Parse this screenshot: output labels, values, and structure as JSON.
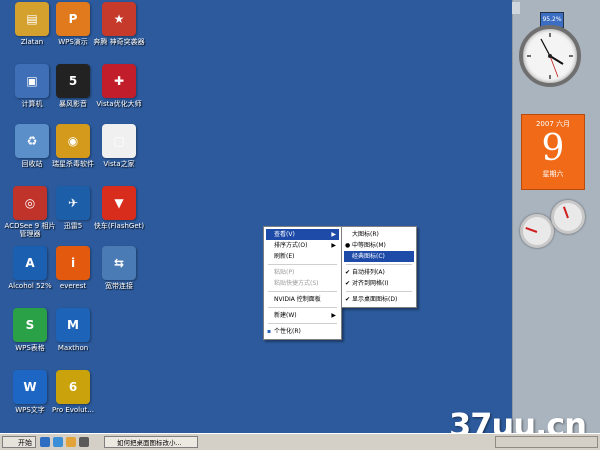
{
  "desktop_icons": [
    {
      "name": "zlatan-folder",
      "label": "Zlatan",
      "color": "#d4a12e",
      "glyph": "▤"
    },
    {
      "name": "wps-presentation",
      "label": "WPS演示",
      "color": "#e07a1c",
      "glyph": "P"
    },
    {
      "name": "benteng-game",
      "label": "奔腾 神奇突袭器",
      "color": "#c63a2c",
      "glyph": "★"
    },
    {
      "name": "computer",
      "label": "计算机",
      "color": "#3f6fb6",
      "glyph": "▣"
    },
    {
      "name": "baofeng-player",
      "label": "暴风影音",
      "color": "#222222",
      "glyph": "5"
    },
    {
      "name": "vista-optimizer",
      "label": "Vista优化大师",
      "color": "#c21d2a",
      "glyph": "✚"
    },
    {
      "name": "recycle-bin",
      "label": "回收站",
      "color": "#5a8fc9",
      "glyph": "♻"
    },
    {
      "name": "rising-antivirus",
      "label": "瑞星杀毒软件",
      "color": "#d49a1c",
      "glyph": "◉"
    },
    {
      "name": "vista-home",
      "label": "Vista之家",
      "color": "#f0f0f0",
      "glyph": "▢"
    },
    {
      "name": "acdsee",
      "label": "ACDSee 9 相片管理器",
      "color": "#c0332a",
      "glyph": "◎"
    },
    {
      "name": "thunder5",
      "label": "迅雷5",
      "color": "#1d5ea8",
      "glyph": "✈"
    },
    {
      "name": "flashget",
      "label": "快车(FlashGet)",
      "color": "#d82c1c",
      "glyph": "▼"
    },
    {
      "name": "alcohol",
      "label": "Alcohol 52%",
      "color": "#1b5fb0",
      "glyph": "A"
    },
    {
      "name": "everest",
      "label": "everest",
      "color": "#e35a0f",
      "glyph": "i"
    },
    {
      "name": "broadband",
      "label": "宽带连接",
      "color": "#4b7bb5",
      "glyph": "⇆"
    },
    {
      "name": "wps-spreadsheet",
      "label": "WPS表格",
      "color": "#2aa047",
      "glyph": "S"
    },
    {
      "name": "maxthon",
      "label": "Maxthon",
      "color": "#1d63b8",
      "glyph": "M"
    },
    {
      "name": "wps-writer",
      "label": "WPS文字",
      "color": "#1e66c3",
      "glyph": "W"
    },
    {
      "name": "pro-evolution",
      "label": "Pro Evolut...",
      "color": "#c9a20c",
      "glyph": "6"
    }
  ],
  "context_menu": {
    "items": [
      {
        "label": "查看(V)",
        "submenu": true,
        "highlight": true
      },
      {
        "label": "排序方式(O)",
        "submenu": true
      },
      {
        "label": "刷新(E)"
      },
      {
        "sep": true
      },
      {
        "label": "粘贴(P)",
        "disabled": true
      },
      {
        "label": "粘贴快捷方式(S)",
        "disabled": true
      },
      {
        "sep": true
      },
      {
        "label": "NVIDIA 控制面板"
      },
      {
        "sep": true
      },
      {
        "label": "新建(W)",
        "submenu": true
      },
      {
        "sep": true
      },
      {
        "label": "个性化(R)",
        "icon": true
      }
    ]
  },
  "view_submenu": {
    "items": [
      {
        "label": "大图标(R)"
      },
      {
        "label": "中等图标(M)",
        "mark": "●"
      },
      {
        "label": "经典图标(C)",
        "highlight": true
      },
      {
        "sep": true
      },
      {
        "label": "自动排列(A)",
        "mark": "✔"
      },
      {
        "label": "对齐到网格(I)",
        "mark": "✔"
      },
      {
        "sep": true
      },
      {
        "label": "显示桌面图标(D)",
        "mark": "✔"
      }
    ]
  },
  "sidebar": {
    "cpu_label": "95.2%",
    "calendar": {
      "header": "2007 六月",
      "day": "9",
      "weekday": "星期六"
    }
  },
  "taskbar": {
    "start_label": "开始",
    "task_label": "如何把桌面图标改小..."
  },
  "watermark": "37uu.cn",
  "colors": {
    "desktop": "#2c5a9c",
    "menu_highlight": "#1e4aa8",
    "calendar": "#f06a18"
  }
}
